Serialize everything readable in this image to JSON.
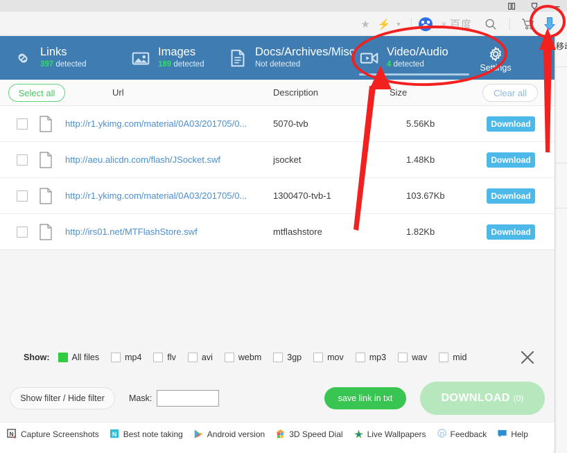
{
  "browser": {
    "window_controls": [
      "restore-icon",
      "pin-icon",
      "minimize-icon"
    ],
    "toolbar": {
      "star_icon": "star-icon",
      "bolt_icon": "lightning-bolt-icon",
      "caret_icon": "chevron-down-icon",
      "engine_logo": "baidu-paw-logo",
      "engine_close": "×",
      "engine_name": "百度",
      "search_icon": "search-icon",
      "cart_icon": "shopping-cart-icon",
      "downloader_icon": "blue-download-arrow-icon"
    },
    "page_text": "移动"
  },
  "tabs": [
    {
      "icon": "link-chain-icon",
      "title": "Links",
      "count": "397",
      "sub_suffix": " detected",
      "sub_text": "397 detected",
      "active": false
    },
    {
      "icon": "image-icon",
      "title": "Images",
      "count": "189",
      "sub_suffix": " detected",
      "sub_text": "189 detected",
      "active": false
    },
    {
      "icon": "document-icon",
      "title": "Docs/Archives/Misc",
      "count": "",
      "sub_suffix": "",
      "sub_text": "Not detected",
      "active": false
    },
    {
      "icon": "video-camera-icon",
      "title": "Video/Audio",
      "count": "4",
      "sub_suffix": " detected",
      "sub_text": "4 detected",
      "active": true
    }
  ],
  "settings": {
    "icon": "gear-icon",
    "label": "Settings"
  },
  "table": {
    "select_all_label": "Select all",
    "clear_all_label": "Clear all",
    "columns": [
      "Url",
      "Description",
      "Size"
    ],
    "download_label": "Download",
    "rows": [
      {
        "checked": false,
        "icon": "file-icon",
        "url": "http://r1.ykimg.com/material/0A03/201705/0...",
        "description": "5070-tvb",
        "size": "5.56Kb"
      },
      {
        "checked": false,
        "icon": "file-icon",
        "url": "http://aeu.alicdn.com/flash/JSocket.swf",
        "description": "jsocket",
        "size": "1.48Kb"
      },
      {
        "checked": false,
        "icon": "file-icon",
        "url": "http://r1.ykimg.com/material/0A03/201705/0...",
        "description": "1300470-tvb-1",
        "size": "103.67Kb"
      },
      {
        "checked": false,
        "icon": "file-icon",
        "url": "http://irs01.net/MTFlashStore.swf",
        "description": "mtflashstore",
        "size": "1.82Kb"
      }
    ]
  },
  "filter": {
    "show_label": "Show:",
    "close_icon": "close-icon",
    "options": [
      {
        "label": "All files",
        "checked": true
      },
      {
        "label": "mp4",
        "checked": false
      },
      {
        "label": "flv",
        "checked": false
      },
      {
        "label": "avi",
        "checked": false
      },
      {
        "label": "webm",
        "checked": false
      },
      {
        "label": "3gp",
        "checked": false
      },
      {
        "label": "mov",
        "checked": false
      },
      {
        "label": "mp3",
        "checked": false
      },
      {
        "label": "wav",
        "checked": false
      },
      {
        "label": "mid",
        "checked": false
      }
    ]
  },
  "actions": {
    "show_filter_label": "Show filter / Hide filter",
    "mask_label": "Mask:",
    "mask_value": "",
    "mask_placeholder": "",
    "save_link_label": "save link in txt",
    "download_label": "DOWNLOAD",
    "download_count": "(0)"
  },
  "footer_links": [
    {
      "icon": "evernote-capture-icon",
      "label": "Capture Screenshots"
    },
    {
      "icon": "evernote-note-icon",
      "label": "Best note taking"
    },
    {
      "icon": "google-play-icon",
      "label": "Android version"
    },
    {
      "icon": "speed-dial-house-icon",
      "label": "3D Speed Dial"
    },
    {
      "icon": "live-wallpapers-icon",
      "label": "Live Wallpapers"
    },
    {
      "icon": "at-sign-icon",
      "label": "Feedback"
    },
    {
      "icon": "speech-bubble-icon",
      "label": "Help"
    }
  ],
  "colors": {
    "tab_bar_blue": "#3e7cb1",
    "accent_green": "#2ee05c",
    "row_download_blue": "#4cb9e8",
    "save_link_green": "#38c552",
    "big_download_green": "#b7e8bd",
    "annotation_red": "#f32020",
    "url_link_blue": "#4d8fd1"
  }
}
